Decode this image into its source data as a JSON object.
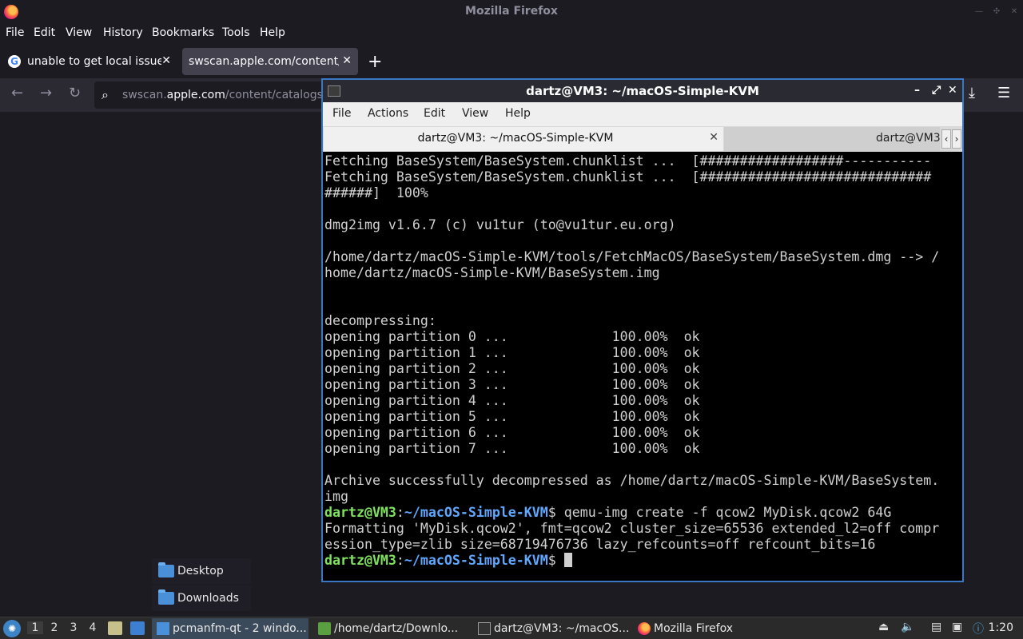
{
  "firefox": {
    "window_title": "Mozilla Firefox",
    "menu": [
      "File",
      "Edit",
      "View",
      "History",
      "Bookmarks",
      "Tools",
      "Help"
    ],
    "tabs": [
      {
        "label": "unable to get local issuer",
        "icon": "google-icon",
        "active": false
      },
      {
        "label": "swscan.apple.com/content/c",
        "active": true
      }
    ],
    "url_host": "swscan.apple.com",
    "url_prefix": "swscan.",
    "url_domain": "apple.com",
    "url_path": "/content/catalogs"
  },
  "desktop": {
    "items": [
      {
        "label": "Desktop"
      },
      {
        "label": "Downloads"
      }
    ]
  },
  "terminal": {
    "window_title": "dartz@VM3: ~/macOS-Simple-KVM",
    "menu": [
      "File",
      "Actions",
      "Edit",
      "View",
      "Help"
    ],
    "tabs": [
      {
        "label": "dartz@VM3: ~/macOS-Simple-KVM",
        "active": true
      },
      {
        "label": "dartz@VM3",
        "active": false
      }
    ],
    "lines": [
      "Fetching BaseSystem/BaseSystem.chunklist ...  [##################-----------",
      "Fetching BaseSystem/BaseSystem.chunklist ...  [#############################",
      "######]  100%",
      "",
      "dmg2img v1.6.7 (c) vu1tur (to@vu1tur.eu.org)",
      "",
      "/home/dartz/macOS-Simple-KVM/tools/FetchMacOS/BaseSystem/BaseSystem.dmg --> /",
      "home/dartz/macOS-Simple-KVM/BaseSystem.img",
      "",
      "",
      "decompressing:",
      "opening partition 0 ...             100.00%  ok",
      "opening partition 1 ...             100.00%  ok",
      "opening partition 2 ...             100.00%  ok",
      "opening partition 3 ...             100.00%  ok",
      "opening partition 4 ...             100.00%  ok",
      "opening partition 5 ...             100.00%  ok",
      "opening partition 6 ...             100.00%  ok",
      "opening partition 7 ...             100.00%  ok",
      "",
      "Archive successfully decompressed as /home/dartz/macOS-Simple-KVM/BaseSystem.",
      "img"
    ],
    "prompt_user": "dartz@VM3",
    "prompt_sep": ":",
    "prompt_path": "~/macOS-Simple-KVM",
    "prompt_dollar": "$ ",
    "command": "qemu-img create -f qcow2 MyDisk.qcow2 64G",
    "output": [
      "Formatting 'MyDisk.qcow2', fmt=qcow2 cluster_size=65536 extended_l2=off compr",
      "ession_type=zlib size=68719476736 lazy_refcounts=off refcount_bits=16"
    ]
  },
  "taskbar": {
    "workspaces": [
      "1",
      "2",
      "3",
      "4"
    ],
    "tasks": [
      {
        "label": "pcmanfm-qt - 2 windo...",
        "active": true
      },
      {
        "label": "/home/dartz/Downlo...",
        "active": false
      },
      {
        "label": "dartz@VM3: ~/macOS...",
        "active": false
      },
      {
        "label": "Mozilla Firefox",
        "active": false
      }
    ],
    "clock": "1:20"
  }
}
